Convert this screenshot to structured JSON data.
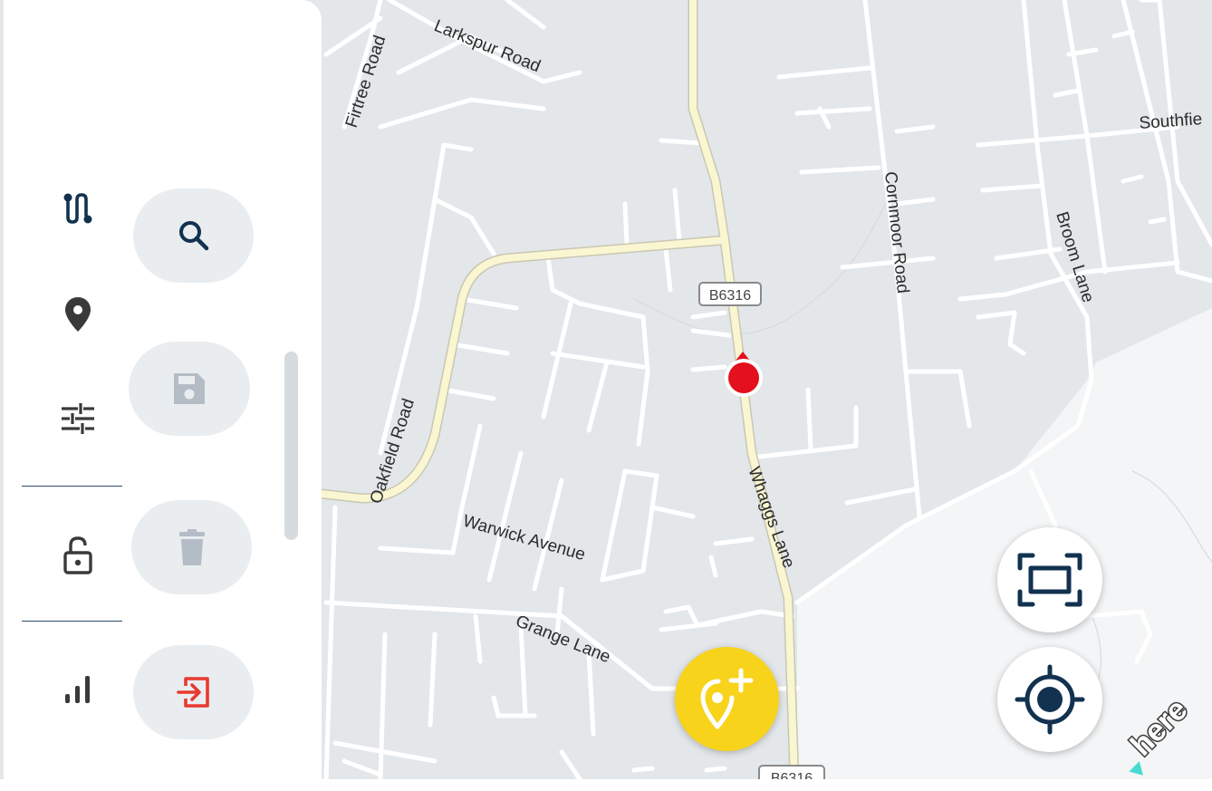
{
  "map": {
    "road_labels": {
      "firtree": "Firtree Road",
      "larkspur": "Larkspur Road",
      "southfield": "Southfie",
      "cornmoor": "Cornmoor Road",
      "broom": "Broom Lane",
      "oakfield": "Oakfield Road",
      "warwick": "Warwick Avenue",
      "grange": "Grange Lane",
      "whaggs": "Whaggs Lane"
    },
    "road_shield": "B6316",
    "road_shield_bottom": "B6316",
    "logo": "here",
    "colors": {
      "land": "#e3e7ea",
      "open_area": "#f3f5f6",
      "minor_road": "#ffffff",
      "major_road": "#faf6d2",
      "marker": "#e4101d"
    }
  },
  "sidebar": {
    "nav": [
      {
        "icon": "route-icon"
      },
      {
        "icon": "location-pin-icon"
      },
      {
        "icon": "sliders-icon"
      },
      {
        "icon": "unlock-icon"
      },
      {
        "icon": "signal-bars-icon"
      }
    ],
    "actions": [
      {
        "icon": "search-icon",
        "enabled": true
      },
      {
        "icon": "save-icon",
        "enabled": false
      },
      {
        "icon": "delete-icon",
        "enabled": false
      },
      {
        "icon": "exit-icon",
        "enabled": true,
        "color": "#e8392f"
      }
    ]
  },
  "fabs": {
    "add_place": {
      "icon": "add-location-icon",
      "color": "#f8d31b"
    },
    "fit_view": {
      "icon": "fit-screen-icon"
    },
    "my_location": {
      "icon": "my-location-icon"
    }
  },
  "colors": {
    "icon_dark": "#12324f",
    "icon_disabled": "#b4bdc6",
    "pill_bg": "#e9edf0"
  }
}
